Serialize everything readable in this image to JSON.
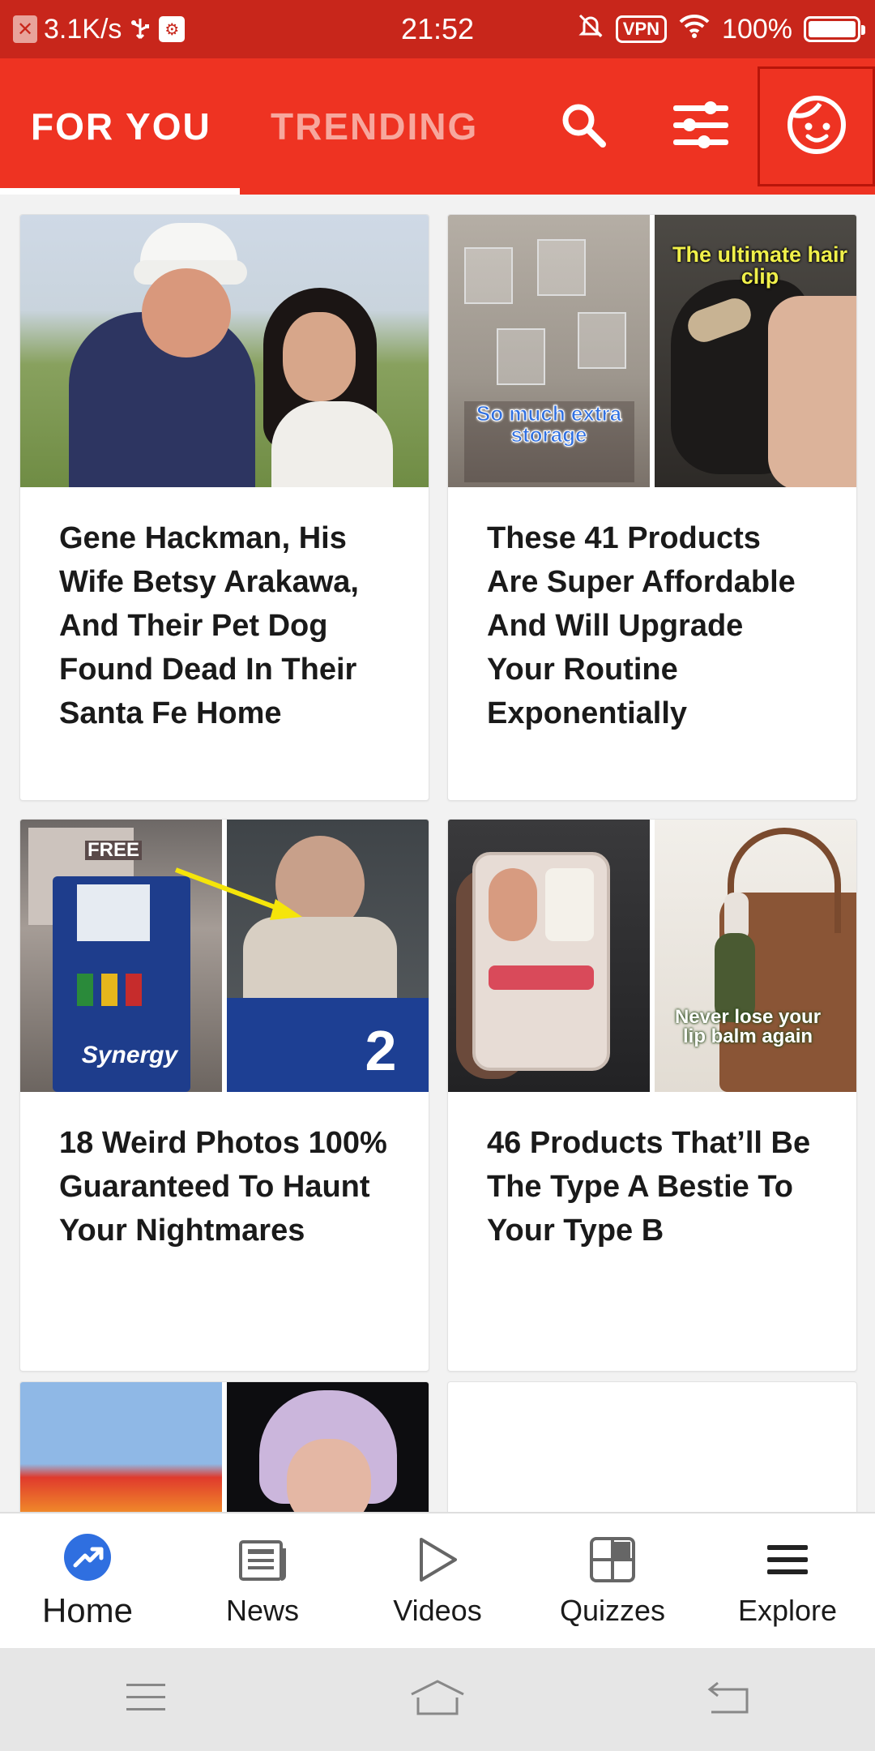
{
  "status_bar": {
    "net_speed": "3.1K/s",
    "time": "21:52",
    "vpn": "VPN",
    "battery": "100%"
  },
  "header": {
    "tabs": [
      {
        "label": "FOR YOU",
        "active": true
      },
      {
        "label": "TRENDING",
        "active": false
      }
    ],
    "icons": [
      "search-icon",
      "filter-sliders-icon",
      "profile-face-icon"
    ]
  },
  "colors": {
    "brand_red": "#ee3322",
    "status_red": "#c8261b",
    "accent_blue": "#2f6fe0"
  },
  "feed": {
    "cards": [
      {
        "title": "Gene Hackman, His Wife Betsy Arakawa, And Their Pet Dog Found Dead In Their Santa Fe Home"
      },
      {
        "title": "These 41 Products Are Super Affordable And Will Upgrade Your Routine Exponentially",
        "image_captions": [
          "So much extra storage",
          "The ultimate hair clip"
        ]
      },
      {
        "title": "18 Weird Photos 100% Guaranteed To Haunt Your Nightmares",
        "image_texts": [
          "FREE",
          "Synergy",
          "2"
        ]
      },
      {
        "title": "46 Products That’ll Be The Type A Bestie To Your Type B",
        "image_captions": [
          "Never lose your lip balm again"
        ]
      }
    ]
  },
  "bottom_nav": {
    "items": [
      {
        "label": "Home",
        "icon": "trending-up-icon",
        "active": true
      },
      {
        "label": "News",
        "icon": "newspaper-icon",
        "active": false
      },
      {
        "label": "Videos",
        "icon": "play-icon",
        "active": false
      },
      {
        "label": "Quizzes",
        "icon": "grid-icon",
        "active": false
      },
      {
        "label": "Explore",
        "icon": "menu-icon",
        "active": false
      }
    ]
  },
  "system_nav": {
    "icons": [
      "recents-icon",
      "home-icon",
      "back-icon"
    ]
  }
}
